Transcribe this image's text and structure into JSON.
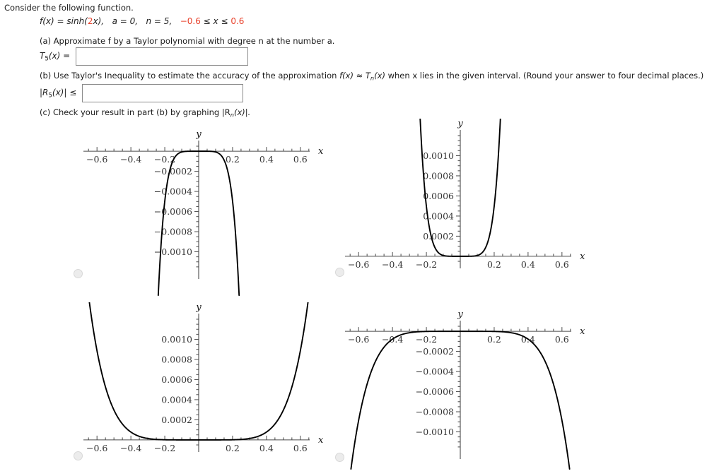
{
  "intro": "Consider the following function.",
  "function_line": {
    "fx": "f(x) = sinh(",
    "coef": "2",
    "fx_tail": "x),",
    "a_part": "a = 0,",
    "n_part": "n = 5,",
    "interval_lo": "−0.6",
    "interval_mid": " ≤ x ≤ ",
    "interval_hi": "0.6"
  },
  "part_a": {
    "text": "(a) Approximate f by a Taylor polynomial with degree n at the number a.",
    "label_pre": "T",
    "label_sub": "5",
    "label_post": "(x) =",
    "value": "",
    "placeholder": ""
  },
  "part_b": {
    "text_1": "(b) Use Taylor's Inequality to estimate the accuracy of the approximation ",
    "text_2": "f(x) ≈ T",
    "text_2_sub": "n",
    "text_3": "(x)",
    "text_4": " when x lies in the given interval. (Round your answer to four decimal places.)",
    "label_pre": "|R",
    "label_sub": "5",
    "label_post": "(x)| ≤",
    "value": "",
    "placeholder": ""
  },
  "part_c": {
    "text_pre": "(c) Check your result in part (b) by graphing  |R",
    "text_sub": "n",
    "text_post": "(x)|."
  },
  "colors": {
    "accent_red": "#e8402a",
    "text": "#222222",
    "curve": "#000000",
    "axis": "#4a4a4a",
    "box_border": "#8b8b8b",
    "radio_fill": "#ececec"
  },
  "chart_data": [
    {
      "id": "graph-1",
      "type": "line",
      "title": "",
      "xlabel": "x",
      "ylabel": "y",
      "xlim": [
        -0.68,
        0.68
      ],
      "ylim": [
        -0.0012,
        5e-05
      ],
      "xticks": [
        -0.6,
        -0.4,
        -0.2,
        0.2,
        0.4,
        0.6
      ],
      "xticklabels": [
        "−0.6",
        "−0.4",
        "−0.2",
        "0.2",
        "0.4",
        "0.6"
      ],
      "yticks": [
        -0.0002,
        -0.0004,
        -0.0006,
        -0.0008,
        -0.001
      ],
      "yticklabels": [
        "−0.0002",
        "−0.0004",
        "−0.0006",
        "−0.0008",
        "−0.0010"
      ],
      "minor_tick_step_x": 0.05,
      "minor_tick_step_y": 5e-05,
      "grid": false,
      "legend": false,
      "description": "narrow inverted peak at x=0 plunging to large negative values near x=±0.22",
      "curve_kind": "narrow-negative-peak",
      "x": [
        -0.26,
        -0.24,
        -0.22,
        -0.2,
        -0.18,
        -0.16,
        -0.14,
        -0.12,
        -0.1,
        -0.08,
        -0.06,
        -0.04,
        -0.02,
        0.0,
        0.02,
        0.04,
        0.06,
        0.08,
        0.1,
        0.12,
        0.14,
        0.16,
        0.18,
        0.2,
        0.22,
        0.24,
        0.26
      ],
      "y": [
        -0.0024,
        -0.0017,
        -0.00118,
        -0.00078,
        -0.00049,
        -0.00029,
        -0.000155,
        -7.4e-05,
        -3.1e-05,
        -1.05e-05,
        -2.7e-06,
        -3.6e-07,
        -0.0,
        0.0,
        -0.0,
        -3.6e-07,
        -2.7e-06,
        -1.05e-05,
        -3.1e-05,
        -7.4e-05,
        -0.000155,
        -0.00029,
        -0.00049,
        -0.00078,
        -0.00118,
        -0.0017,
        -0.0024
      ]
    },
    {
      "id": "graph-2",
      "type": "line",
      "title": "",
      "xlabel": "x",
      "ylabel": "y",
      "xlim": [
        -0.68,
        0.68
      ],
      "ylim": [
        -5e-05,
        0.0012
      ],
      "xticks": [
        -0.6,
        -0.4,
        -0.2,
        0.2,
        0.4,
        0.6
      ],
      "xticklabels": [
        "−0.6",
        "−0.4",
        "−0.2",
        "0.2",
        "0.4",
        "0.6"
      ],
      "yticks": [
        0.0002,
        0.0004,
        0.0006,
        0.0008,
        0.001
      ],
      "yticklabels": [
        "0.0002",
        "0.0004",
        "0.0006",
        "0.0008",
        "0.0010"
      ],
      "minor_tick_step_x": 0.05,
      "minor_tick_step_y": 5e-05,
      "grid": false,
      "legend": false,
      "description": "narrow upward U, flat near zero, rising steeply past x=±0.15",
      "curve_kind": "narrow-positive-u",
      "x": [
        -0.26,
        -0.24,
        -0.22,
        -0.2,
        -0.18,
        -0.16,
        -0.14,
        -0.12,
        -0.1,
        -0.08,
        -0.06,
        -0.04,
        -0.02,
        0.0,
        0.02,
        0.04,
        0.06,
        0.08,
        0.1,
        0.12,
        0.14,
        0.16,
        0.18,
        0.2,
        0.22,
        0.24,
        0.26
      ],
      "y": [
        0.0024,
        0.0017,
        0.00118,
        0.00078,
        0.00049,
        0.00029,
        0.000155,
        7.4e-05,
        3.1e-05,
        1.05e-05,
        2.7e-06,
        3.6e-07,
        0.0,
        0.0,
        0.0,
        3.6e-07,
        2.7e-06,
        1.05e-05,
        3.1e-05,
        7.4e-05,
        0.000155,
        0.00029,
        0.00049,
        0.00078,
        0.00118,
        0.0017,
        0.0024
      ]
    },
    {
      "id": "graph-3",
      "type": "line",
      "title": "",
      "xlabel": "x",
      "ylabel": "y",
      "xlim": [
        -0.68,
        0.68
      ],
      "ylim": [
        -5e-05,
        0.0012
      ],
      "xticks": [
        -0.6,
        -0.4,
        -0.2,
        0.2,
        0.4,
        0.6
      ],
      "xticklabels": [
        "−0.6",
        "−0.4",
        "−0.2",
        "0.2",
        "0.4",
        "0.6"
      ],
      "yticks": [
        0.0002,
        0.0004,
        0.0006,
        0.0008,
        0.001
      ],
      "yticklabels": [
        "0.0002",
        "0.0004",
        "0.0006",
        "0.0008",
        "0.0010"
      ],
      "minor_tick_step_x": 0.05,
      "minor_tick_step_y": 5e-05,
      "grid": false,
      "legend": false,
      "description": "wide upward U, near zero across the middle, rising to about 0.0010 at x=±0.6",
      "curve_kind": "wide-positive-u",
      "x": [
        -0.62,
        -0.6,
        -0.55,
        -0.5,
        -0.45,
        -0.4,
        -0.35,
        -0.3,
        -0.25,
        -0.2,
        -0.1,
        0.0,
        0.1,
        0.2,
        0.25,
        0.3,
        0.35,
        0.4,
        0.45,
        0.5,
        0.55,
        0.6,
        0.62
      ],
      "y": [
        0.00108,
        0.00094,
        0.00061,
        0.00037,
        0.00021,
        0.00011,
        5.3e-05,
        2.3e-05,
        8.7e-06,
        2.8e-06,
        8e-08,
        0.0,
        8e-08,
        2.8e-06,
        8.7e-06,
        2.3e-05,
        5.3e-05,
        0.00011,
        0.00021,
        0.00037,
        0.00061,
        0.00094,
        0.00108
      ]
    },
    {
      "id": "graph-4",
      "type": "line",
      "title": "",
      "xlabel": "x",
      "ylabel": "y",
      "xlim": [
        -0.68,
        0.68
      ],
      "ylim": [
        -0.0012,
        5e-05
      ],
      "xticks": [
        -0.6,
        -0.4,
        -0.2,
        0.2,
        0.4,
        0.6
      ],
      "xticklabels": [
        "−0.6",
        "−0.4",
        "−0.2",
        "0.2",
        "0.4",
        "0.6"
      ],
      "yticks": [
        -0.0002,
        -0.0004,
        -0.0006,
        -0.0008,
        -0.001
      ],
      "yticklabels": [
        "−0.0002",
        "−0.0004",
        "−0.0006",
        "−0.0008",
        "−0.0010"
      ],
      "minor_tick_step_x": 0.05,
      "minor_tick_step_y": 5e-05,
      "grid": false,
      "legend": false,
      "description": "wide inverted U, near zero across the middle, falling to about −0.0010 at x=±0.6",
      "curve_kind": "wide-negative-u",
      "x": [
        -0.62,
        -0.6,
        -0.55,
        -0.5,
        -0.45,
        -0.4,
        -0.35,
        -0.3,
        -0.25,
        -0.2,
        -0.1,
        0.0,
        0.1,
        0.2,
        0.25,
        0.3,
        0.35,
        0.4,
        0.45,
        0.5,
        0.55,
        0.6,
        0.62
      ],
      "y": [
        -0.00108,
        -0.00094,
        -0.00061,
        -0.00037,
        -0.00021,
        -0.00011,
        -5.3e-05,
        -2.3e-05,
        -8.7e-06,
        -2.8e-06,
        -8e-08,
        0.0,
        -8e-08,
        -2.8e-06,
        -8.7e-06,
        -2.3e-05,
        -5.3e-05,
        -0.00011,
        -0.00021,
        -0.00037,
        -0.00061,
        -0.00094,
        -0.00108
      ]
    }
  ],
  "options": [
    {
      "id": "option-1",
      "selected": false
    },
    {
      "id": "option-2",
      "selected": false
    },
    {
      "id": "option-3",
      "selected": false
    },
    {
      "id": "option-4",
      "selected": false
    }
  ]
}
